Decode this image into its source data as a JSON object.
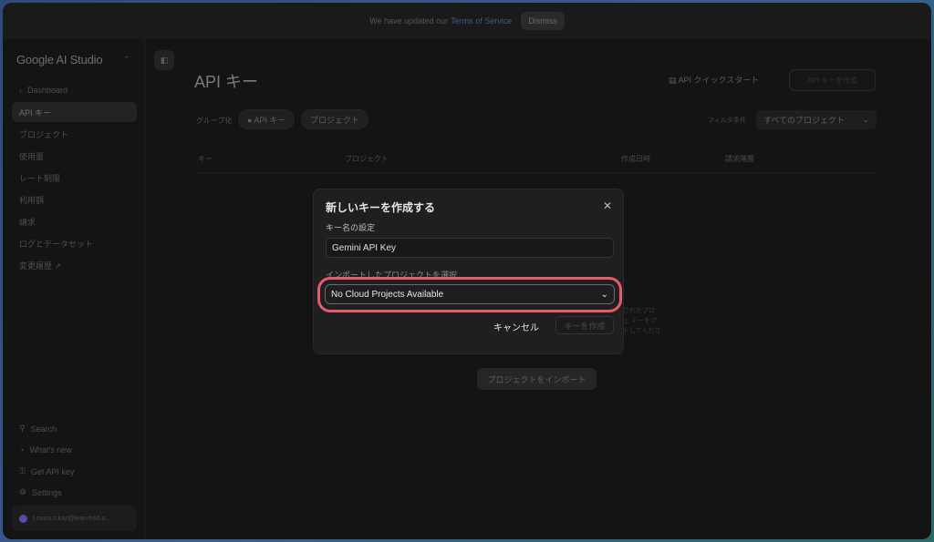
{
  "banner": {
    "text": "We have updated our",
    "tos_link": "Terms of Service",
    "dismiss_label": "Dismiss"
  },
  "sidebar": {
    "brand": "Google AI Studio",
    "items": [
      {
        "label": "Dashboard",
        "icon": "chevron-left-icon"
      },
      {
        "label": "API キー"
      },
      {
        "label": "プロジェクト"
      },
      {
        "label": "使用量"
      },
      {
        "label": "レート制限"
      },
      {
        "label": "利用額"
      },
      {
        "label": "請求"
      },
      {
        "label": "ログとデータセット"
      },
      {
        "label": "変更履歴 ↗"
      }
    ],
    "bottom": [
      {
        "label": "Search",
        "icon": "search-icon"
      },
      {
        "label": "What's new",
        "icon": "bell-icon"
      },
      {
        "label": "Get API key",
        "icon": "key-icon"
      },
      {
        "label": "Settings",
        "icon": "gear-icon"
      }
    ],
    "account": "t.mura.n.kaz@lean-fred.a..."
  },
  "header": {
    "title": "API キー",
    "quickstart": "API クイックスタート",
    "create_key": "API キーを作成"
  },
  "toolbar": {
    "group_label": "グループ化",
    "chip_api_key": "● API キー",
    "chip_project": "プロジェクト",
    "filter_label": "フィルタ条件",
    "filter_value": "すべてのプロジェクト"
  },
  "table": {
    "headers": [
      "キー",
      "プロジェクト",
      "作成日時",
      "請求階層"
    ]
  },
  "background_text": {
    "line1": "されたプロ",
    "line2": "ェ キーをプ",
    "line3": "トしてくださ"
  },
  "import_button": "プロジェクトをインポート",
  "modal": {
    "title": "新しいキーを作成する",
    "name_label": "キー名の設定",
    "name_value": "Gemini API Key",
    "project_label": "インポートしたプロジェクトを選択",
    "project_value": "No Cloud Projects Available",
    "cancel": "キャンセル",
    "create": "キーを作成"
  },
  "colors": {
    "highlight": "#e8596b",
    "background": "#141414"
  }
}
